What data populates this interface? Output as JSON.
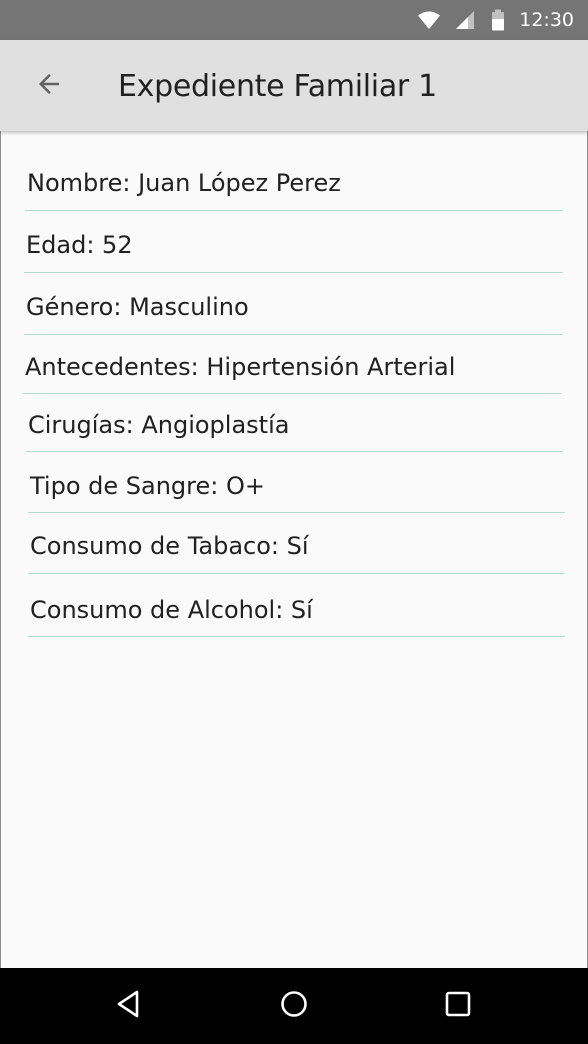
{
  "status_bar": {
    "time": "12:30",
    "icons": [
      "wifi-icon",
      "signal-icon",
      "battery-icon"
    ]
  },
  "app_bar": {
    "back_icon": "arrow-back-icon",
    "title": "Expediente Familiar 1"
  },
  "fields": [
    {
      "name": "field-nombre",
      "text": "Nombre: Juan López Perez"
    },
    {
      "name": "field-edad",
      "text": "Edad: 52"
    },
    {
      "name": "field-genero",
      "text": "Género: Masculino"
    },
    {
      "name": "field-antecedentes",
      "text": "Antecedentes: Hipertensión Arterial"
    },
    {
      "name": "field-cirugias",
      "text": "Cirugías: Angioplastía"
    },
    {
      "name": "field-tipo-sangre",
      "text": "Tipo de Sangre: O+"
    },
    {
      "name": "field-consumo-tabaco",
      "text": "Consumo de Tabaco: Sí"
    },
    {
      "name": "field-consumo-alcohol",
      "text": "Consumo de Alcohol: Sí"
    }
  ],
  "nav_bar": {
    "icons": [
      "back-triangle-icon",
      "home-circle-icon",
      "recents-square-icon"
    ]
  },
  "colors": {
    "status_bar": "#757575",
    "app_bar": "#e0e0e0",
    "background": "#fafafa",
    "divider": "#bcd8d2",
    "nav_bar": "#000000"
  }
}
